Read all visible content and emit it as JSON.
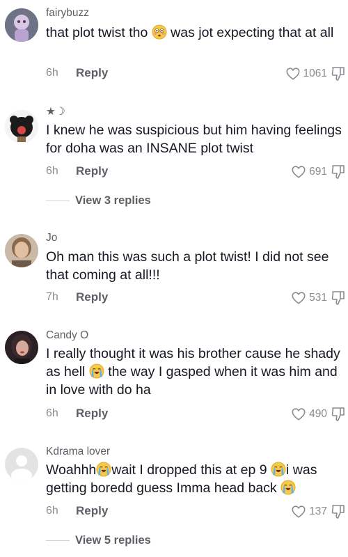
{
  "comments": [
    {
      "username": "fairybuzz",
      "text_a": "that plot twist tho ",
      "text_b": " was jot expecting that at all",
      "time": "6h",
      "reply_label": "Reply",
      "likes": "1061",
      "avatar": "purple-gray-avatar"
    },
    {
      "username": "★☽",
      "text": "I knew he was suspicious but him having feelings for doha was an INSANE plot twist",
      "time": "6h",
      "reply_label": "Reply",
      "likes": "691",
      "view_replies": "View 3 replies",
      "avatar": "dark-character-avatar"
    },
    {
      "username": "Jo",
      "text": "Oh man this was such a plot twist! I did not see that coming at all!!!",
      "time": "7h",
      "reply_label": "Reply",
      "likes": "531",
      "avatar": "photo-avatar"
    },
    {
      "username": "Candy O",
      "text_a": "I really thought it was his brother cause he shady as hell ",
      "text_b": " the way I gasped when it was him and in love with do ha",
      "time": "6h",
      "reply_label": "Reply",
      "likes": "490",
      "avatar": "photo-avatar-dark"
    },
    {
      "username": "Kdrama lover",
      "text_a": "Woahhh",
      "text_b": "wait I dropped this at ep 9 ",
      "text_c": "i was getting boredd guess Imma head back ",
      "time": "6h",
      "reply_label": "Reply",
      "likes": "137",
      "view_replies": "View 5 replies",
      "avatar": "default-gray-avatar"
    }
  ],
  "colors": {
    "text": "#161823",
    "muted": "#8a8b91",
    "reply": "#5d5f66"
  }
}
